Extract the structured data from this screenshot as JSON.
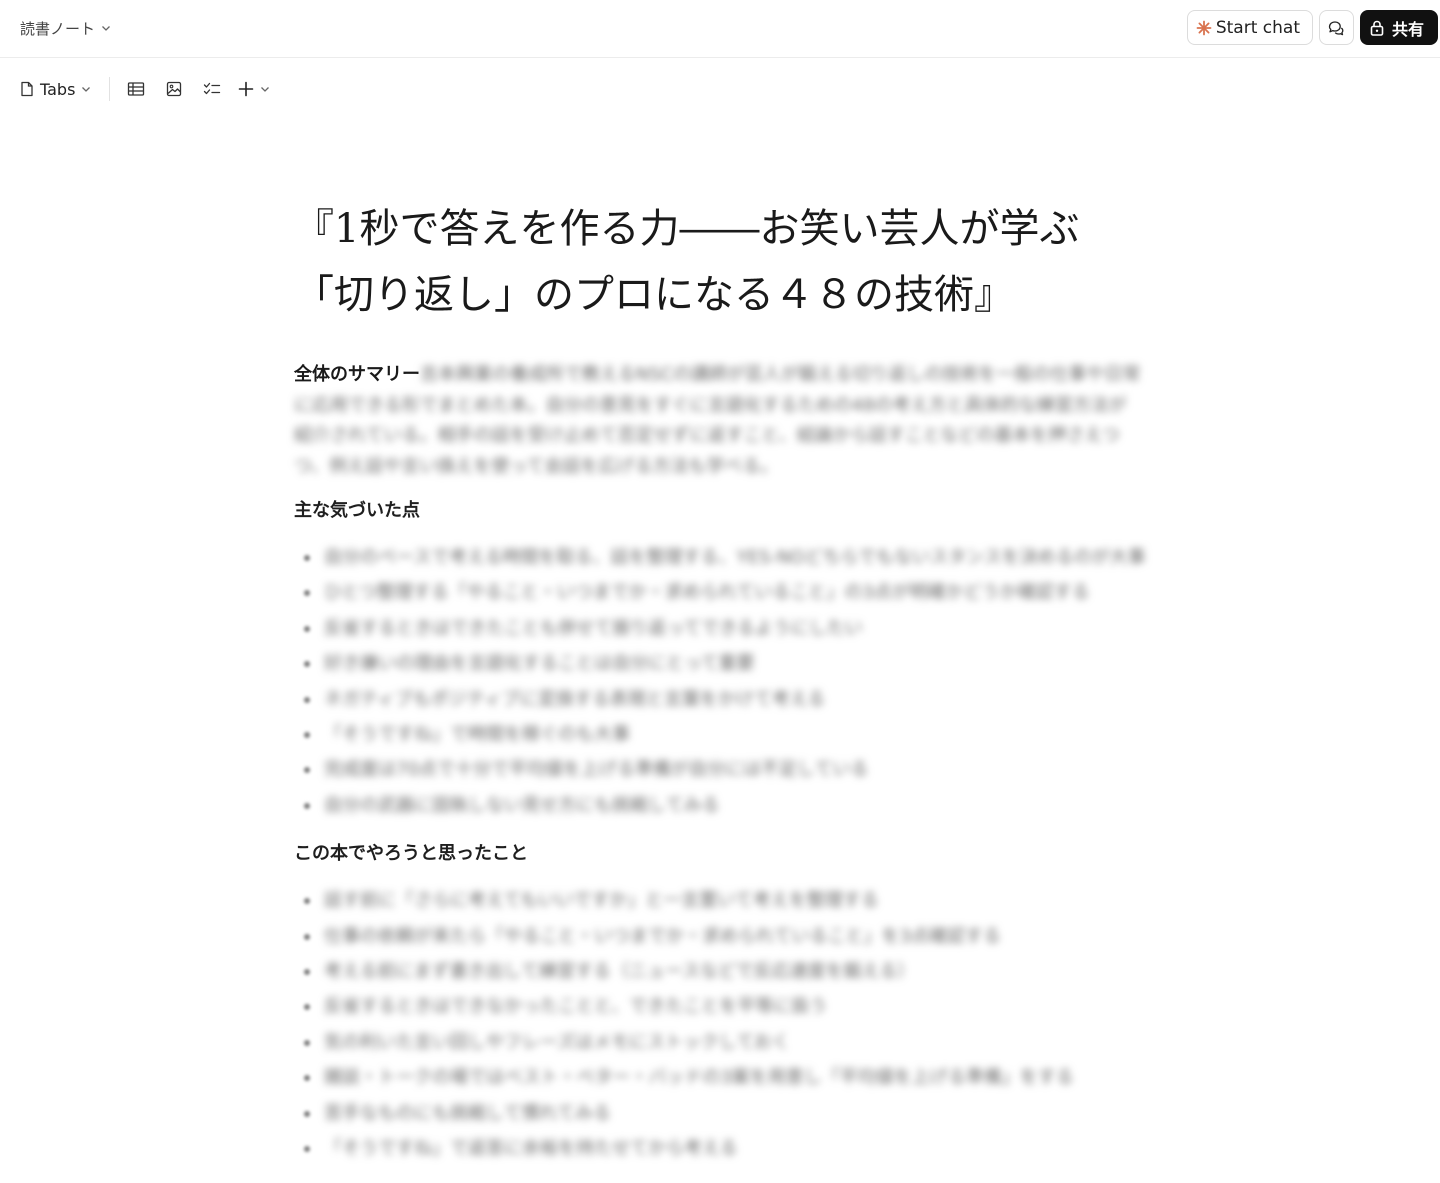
{
  "topbar": {
    "doc_title": "読書ノート",
    "start_chat_label": "Start chat",
    "share_label": "共有",
    "accent_color": "#d9734f"
  },
  "toolbar": {
    "tabs_label": "Tabs",
    "icons": [
      "document-icon",
      "table-icon",
      "image-icon",
      "checklist-icon",
      "plus-icon"
    ]
  },
  "doc": {
    "title_line1": "『1秒で答えを作る力――お笑い芸人が学ぶ",
    "title_line2": "「切り返し」のプロになる４８の技術』",
    "summary_heading": "全体のサマリー",
    "summary_text": "吉本興業の養成所で教えるNSCの講師が芸人が鍛える切り返しの技術を一般の仕事や日常に応用できる形でまとめた本。自分の意見をすぐに言語化するための48の考え方と具体的な練習方法が紹介されている。相手の話を受け止めて否定せずに返すこと、結論から話すことなどの基本を押さえつつ、例え話や言い換えを使って会話を広げる方法も学べる。",
    "insights_heading": "主な気づいた点",
    "insights": [
      "自分のペースで考える時間を取る、話を整理する、YES-NOどちらでもないスタンスを決めるのが大事",
      "ひとつ整理する「やること・いつまでか・求められていること」の3点が明確かどうか確認する",
      "反省するときはできたことも併せて振り返ってできるようにしたい",
      "好き嫌いの理由を言語化することは自分にとって重要",
      "ネガティブもポジティブに変換する表現と言葉をかけて考える",
      "「そうですね」で時間を稼ぐのも大事",
      "完成度は70点で十分で平均値を上げる準備が自分には不足している",
      "自分の武器に固執しない見せ方にも挑戦してみる"
    ],
    "todo_heading": "この本でやろうと思ったこと",
    "todos": [
      "話す前に「さらに考えてもいいですか」と一言置いて考えを整理する",
      "仕事の依頼が来たら「やること・いつまでか・求められていること」を3点確認する",
      "考える前にまず書き出して練習する（ニュースなどで反応速度を鍛える）",
      "反省するときはできなかったことと、できたことを平等に扱う",
      "気の利いた言い回しやフレーズはメモにストックしておく",
      "雑談・トークの場ではベスト・ベター・バッドの3案を用意し「平均値を上げる準備」をする",
      "苦手なものにも挑戦して慣れてみる",
      "「そうですね」で返答に余裕を持たせてから考える"
    ]
  }
}
